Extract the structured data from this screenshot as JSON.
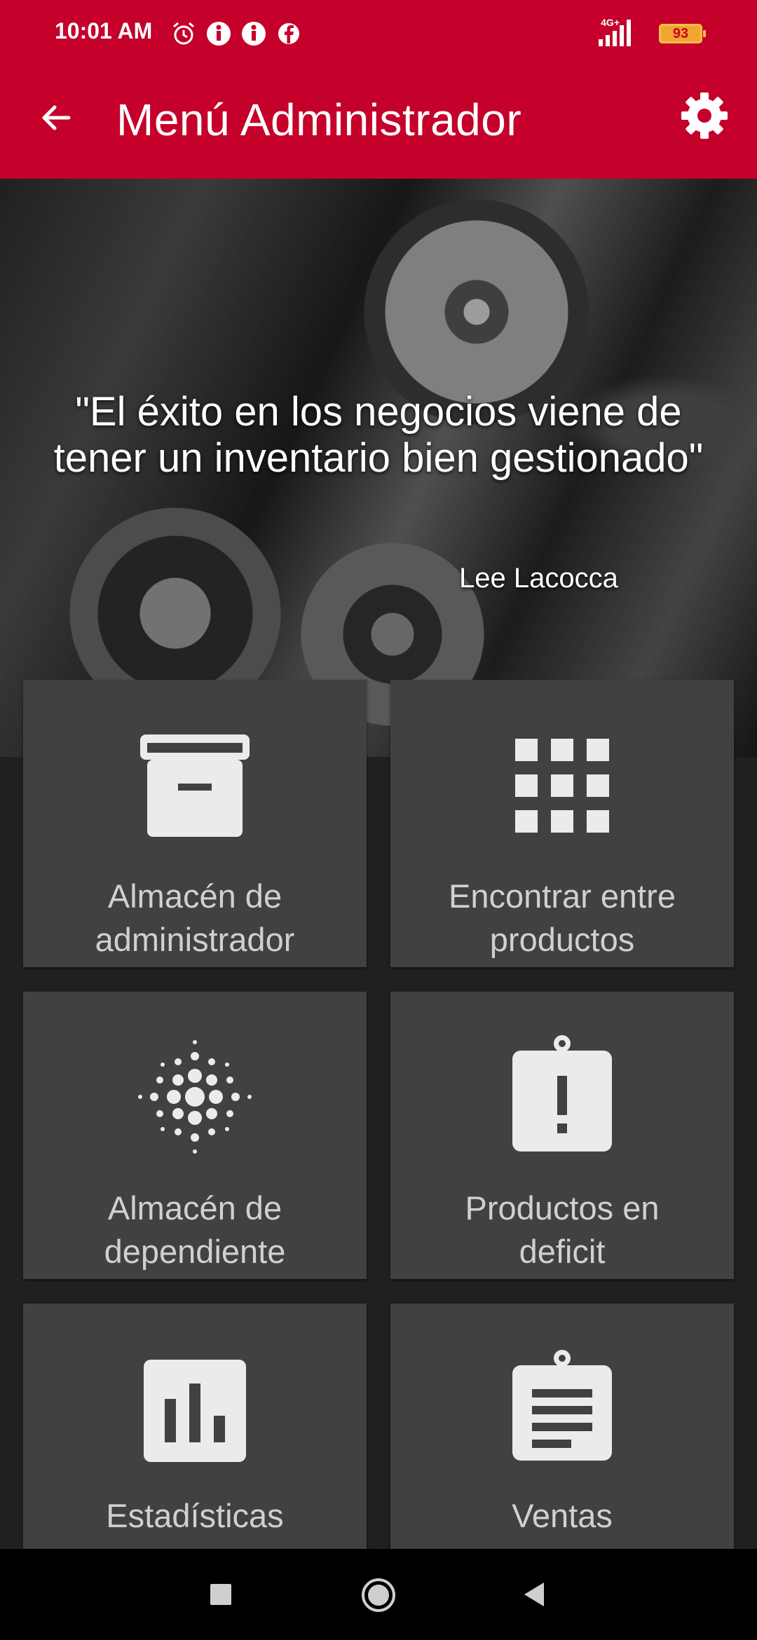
{
  "status_bar": {
    "time": "10:01 AM",
    "network": "4G+",
    "battery": "93"
  },
  "app_bar": {
    "title": "Menú Administrador"
  },
  "hero": {
    "quote": "\"El éxito en los negocios viene de tener un inventario bien gestionado\"",
    "author": "Lee Lacocca"
  },
  "menu": [
    {
      "label_line1": "Almacén de",
      "label_line2": "administrador",
      "icon": "archive-box-icon"
    },
    {
      "label_line1": "Encontrar entre",
      "label_line2": "productos",
      "icon": "grid-icon"
    },
    {
      "label_line1": "Almacén de",
      "label_line2": "dependiente",
      "icon": "dots-burst-icon"
    },
    {
      "label_line1": "Productos en",
      "label_line2": "deficit",
      "icon": "alert-clipboard-icon"
    },
    {
      "label_line1": "Estadísticas",
      "label_line2": "",
      "icon": "bar-chart-icon"
    },
    {
      "label_line1": "Ventas",
      "label_line2": "",
      "icon": "clipboard-list-icon"
    }
  ],
  "colors": {
    "accent": "#c4002b",
    "tile": "#414141",
    "background": "#202020"
  }
}
